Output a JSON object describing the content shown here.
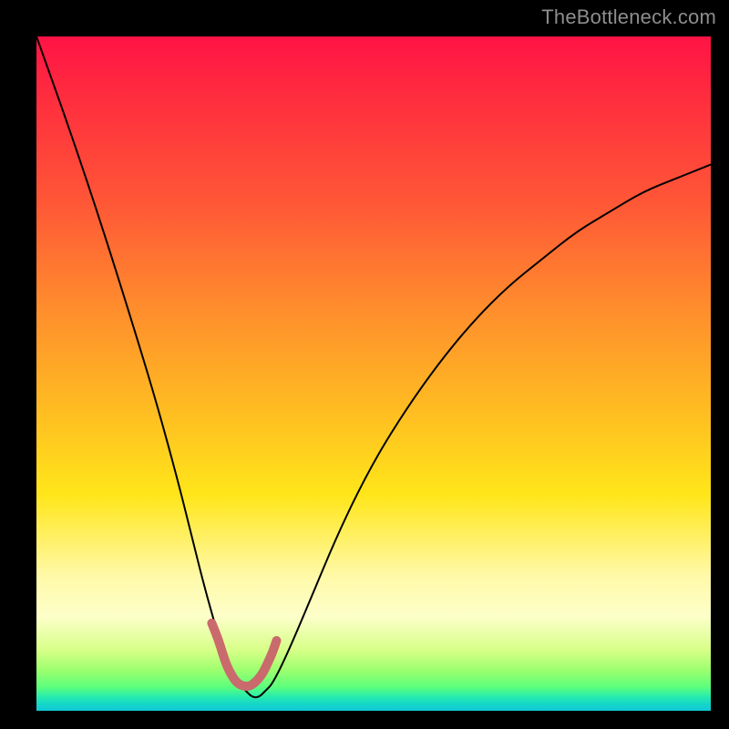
{
  "watermark": "TheBottleneck.com",
  "chart_data": {
    "type": "line",
    "title": "",
    "xlabel": "",
    "ylabel": "",
    "xlim": [
      0,
      100
    ],
    "ylim": [
      0,
      100
    ],
    "grid": false,
    "legend": false,
    "background_gradient": {
      "direction": "vertical",
      "stops": [
        {
          "pos": 0,
          "color": "#ff1345"
        },
        {
          "pos": 25,
          "color": "#ff5836"
        },
        {
          "pos": 55,
          "color": "#ffbb22"
        },
        {
          "pos": 80,
          "color": "#fff9a8"
        },
        {
          "pos": 96,
          "color": "#5cff7d"
        },
        {
          "pos": 100,
          "color": "#0fc9d6"
        }
      ]
    },
    "series": [
      {
        "name": "bottleneck-curve",
        "color": "#000000",
        "width": 2,
        "x": [
          0,
          5,
          10,
          15,
          18,
          21,
          23,
          25,
          27,
          28,
          29,
          30,
          31,
          32,
          33,
          34,
          35,
          37,
          40,
          45,
          50,
          55,
          60,
          65,
          70,
          75,
          80,
          85,
          90,
          95,
          100
        ],
        "values": [
          100,
          86,
          71,
          55,
          45,
          34,
          26,
          18,
          11,
          8,
          6,
          4,
          3,
          2,
          2,
          3,
          4,
          8,
          15,
          27,
          37,
          45,
          52,
          58,
          63,
          67,
          71,
          74,
          77,
          79,
          81
        ]
      },
      {
        "name": "minimum-marker",
        "color": "#c96a6c",
        "width": 10,
        "linecap": "round",
        "x": [
          26,
          27,
          27.7,
          28.3,
          29,
          29.6,
          30.3,
          31,
          31.7,
          32.3,
          33,
          33.7,
          34.3,
          35,
          35.6
        ],
        "values": [
          13,
          10.5,
          8.2,
          6.5,
          5.2,
          4.3,
          3.8,
          3.6,
          3.7,
          4.1,
          4.8,
          5.8,
          7.1,
          8.6,
          10.4
        ]
      }
    ]
  }
}
